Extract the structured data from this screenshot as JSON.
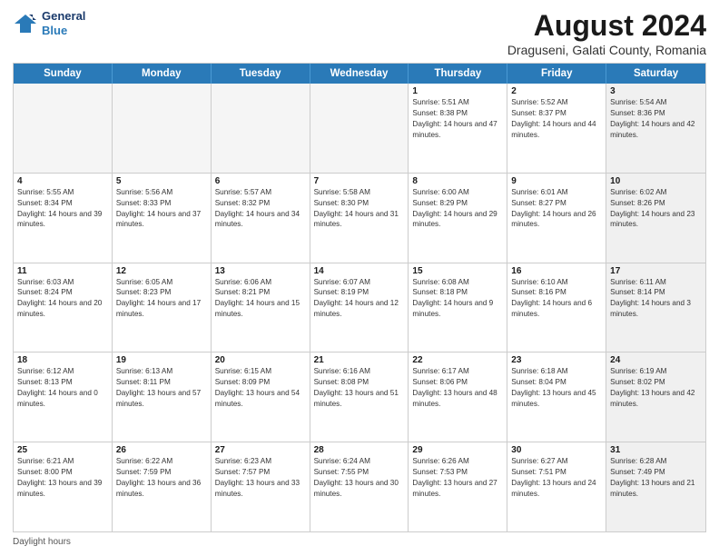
{
  "header": {
    "logo_line1": "General",
    "logo_line2": "Blue",
    "main_title": "August 2024",
    "subtitle": "Draguseni, Galati County, Romania"
  },
  "weekdays": [
    "Sunday",
    "Monday",
    "Tuesday",
    "Wednesday",
    "Thursday",
    "Friday",
    "Saturday"
  ],
  "footer_text": "Daylight hours",
  "rows": [
    [
      {
        "day": "",
        "info": "",
        "empty": true
      },
      {
        "day": "",
        "info": "",
        "empty": true
      },
      {
        "day": "",
        "info": "",
        "empty": true
      },
      {
        "day": "",
        "info": "",
        "empty": true
      },
      {
        "day": "1",
        "info": "Sunrise: 5:51 AM\nSunset: 8:38 PM\nDaylight: 14 hours and 47 minutes.",
        "empty": false
      },
      {
        "day": "2",
        "info": "Sunrise: 5:52 AM\nSunset: 8:37 PM\nDaylight: 14 hours and 44 minutes.",
        "empty": false
      },
      {
        "day": "3",
        "info": "Sunrise: 5:54 AM\nSunset: 8:36 PM\nDaylight: 14 hours and 42 minutes.",
        "empty": false,
        "shaded": true
      }
    ],
    [
      {
        "day": "4",
        "info": "Sunrise: 5:55 AM\nSunset: 8:34 PM\nDaylight: 14 hours and 39 minutes.",
        "empty": false
      },
      {
        "day": "5",
        "info": "Sunrise: 5:56 AM\nSunset: 8:33 PM\nDaylight: 14 hours and 37 minutes.",
        "empty": false
      },
      {
        "day": "6",
        "info": "Sunrise: 5:57 AM\nSunset: 8:32 PM\nDaylight: 14 hours and 34 minutes.",
        "empty": false
      },
      {
        "day": "7",
        "info": "Sunrise: 5:58 AM\nSunset: 8:30 PM\nDaylight: 14 hours and 31 minutes.",
        "empty": false
      },
      {
        "day": "8",
        "info": "Sunrise: 6:00 AM\nSunset: 8:29 PM\nDaylight: 14 hours and 29 minutes.",
        "empty": false
      },
      {
        "day": "9",
        "info": "Sunrise: 6:01 AM\nSunset: 8:27 PM\nDaylight: 14 hours and 26 minutes.",
        "empty": false
      },
      {
        "day": "10",
        "info": "Sunrise: 6:02 AM\nSunset: 8:26 PM\nDaylight: 14 hours and 23 minutes.",
        "empty": false,
        "shaded": true
      }
    ],
    [
      {
        "day": "11",
        "info": "Sunrise: 6:03 AM\nSunset: 8:24 PM\nDaylight: 14 hours and 20 minutes.",
        "empty": false
      },
      {
        "day": "12",
        "info": "Sunrise: 6:05 AM\nSunset: 8:23 PM\nDaylight: 14 hours and 17 minutes.",
        "empty": false
      },
      {
        "day": "13",
        "info": "Sunrise: 6:06 AM\nSunset: 8:21 PM\nDaylight: 14 hours and 15 minutes.",
        "empty": false
      },
      {
        "day": "14",
        "info": "Sunrise: 6:07 AM\nSunset: 8:19 PM\nDaylight: 14 hours and 12 minutes.",
        "empty": false
      },
      {
        "day": "15",
        "info": "Sunrise: 6:08 AM\nSunset: 8:18 PM\nDaylight: 14 hours and 9 minutes.",
        "empty": false
      },
      {
        "day": "16",
        "info": "Sunrise: 6:10 AM\nSunset: 8:16 PM\nDaylight: 14 hours and 6 minutes.",
        "empty": false
      },
      {
        "day": "17",
        "info": "Sunrise: 6:11 AM\nSunset: 8:14 PM\nDaylight: 14 hours and 3 minutes.",
        "empty": false,
        "shaded": true
      }
    ],
    [
      {
        "day": "18",
        "info": "Sunrise: 6:12 AM\nSunset: 8:13 PM\nDaylight: 14 hours and 0 minutes.",
        "empty": false
      },
      {
        "day": "19",
        "info": "Sunrise: 6:13 AM\nSunset: 8:11 PM\nDaylight: 13 hours and 57 minutes.",
        "empty": false
      },
      {
        "day": "20",
        "info": "Sunrise: 6:15 AM\nSunset: 8:09 PM\nDaylight: 13 hours and 54 minutes.",
        "empty": false
      },
      {
        "day": "21",
        "info": "Sunrise: 6:16 AM\nSunset: 8:08 PM\nDaylight: 13 hours and 51 minutes.",
        "empty": false
      },
      {
        "day": "22",
        "info": "Sunrise: 6:17 AM\nSunset: 8:06 PM\nDaylight: 13 hours and 48 minutes.",
        "empty": false
      },
      {
        "day": "23",
        "info": "Sunrise: 6:18 AM\nSunset: 8:04 PM\nDaylight: 13 hours and 45 minutes.",
        "empty": false
      },
      {
        "day": "24",
        "info": "Sunrise: 6:19 AM\nSunset: 8:02 PM\nDaylight: 13 hours and 42 minutes.",
        "empty": false,
        "shaded": true
      }
    ],
    [
      {
        "day": "25",
        "info": "Sunrise: 6:21 AM\nSunset: 8:00 PM\nDaylight: 13 hours and 39 minutes.",
        "empty": false
      },
      {
        "day": "26",
        "info": "Sunrise: 6:22 AM\nSunset: 7:59 PM\nDaylight: 13 hours and 36 minutes.",
        "empty": false
      },
      {
        "day": "27",
        "info": "Sunrise: 6:23 AM\nSunset: 7:57 PM\nDaylight: 13 hours and 33 minutes.",
        "empty": false
      },
      {
        "day": "28",
        "info": "Sunrise: 6:24 AM\nSunset: 7:55 PM\nDaylight: 13 hours and 30 minutes.",
        "empty": false
      },
      {
        "day": "29",
        "info": "Sunrise: 6:26 AM\nSunset: 7:53 PM\nDaylight: 13 hours and 27 minutes.",
        "empty": false
      },
      {
        "day": "30",
        "info": "Sunrise: 6:27 AM\nSunset: 7:51 PM\nDaylight: 13 hours and 24 minutes.",
        "empty": false
      },
      {
        "day": "31",
        "info": "Sunrise: 6:28 AM\nSunset: 7:49 PM\nDaylight: 13 hours and 21 minutes.",
        "empty": false,
        "shaded": true
      }
    ]
  ]
}
